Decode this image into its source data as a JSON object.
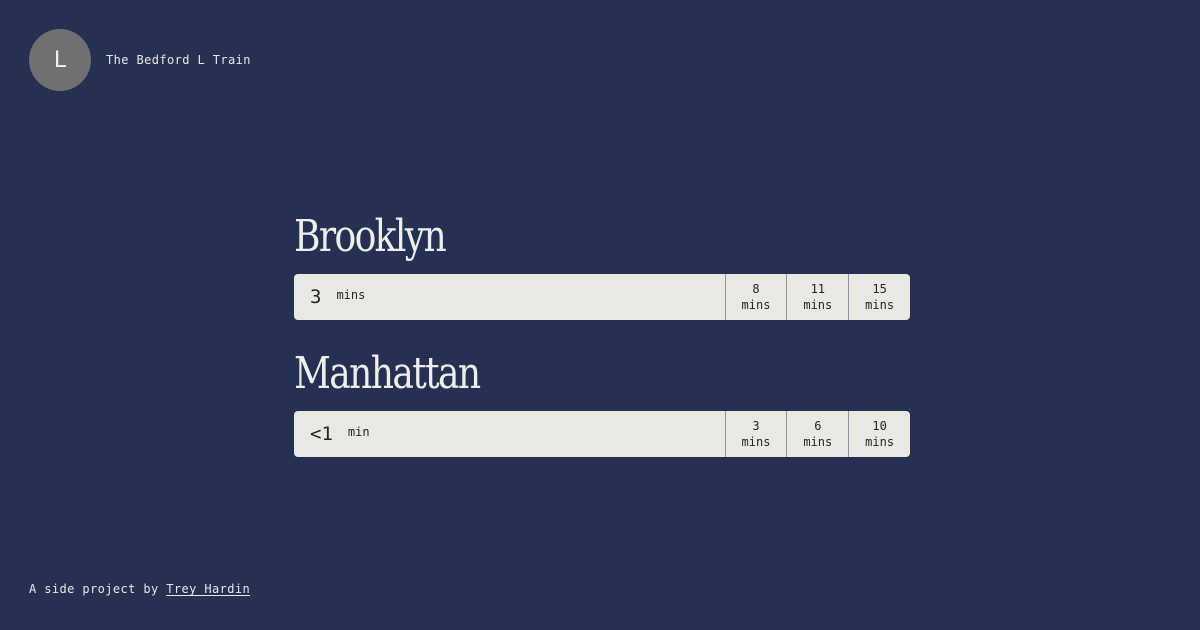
{
  "header": {
    "logo_letter": "L",
    "title": "The Bedford L Train"
  },
  "directions": [
    {
      "name": "Brooklyn",
      "next": {
        "value": "3",
        "unit": "mins"
      },
      "later": [
        {
          "value": "8",
          "unit": "mins"
        },
        {
          "value": "11",
          "unit": "mins"
        },
        {
          "value": "15",
          "unit": "mins"
        }
      ]
    },
    {
      "name": "Manhattan",
      "next": {
        "value": "<1",
        "unit": "min"
      },
      "later": [
        {
          "value": "3",
          "unit": "mins"
        },
        {
          "value": "6",
          "unit": "mins"
        },
        {
          "value": "10",
          "unit": "mins"
        }
      ]
    }
  ],
  "footer": {
    "prefix": "A side project by",
    "author_link": "Trey Hardin"
  },
  "colors": {
    "background": "#263053",
    "bar": "#e9e8e3",
    "logo": "#707070",
    "text_light": "#e9e8e2",
    "text_dark": "#22252d"
  }
}
